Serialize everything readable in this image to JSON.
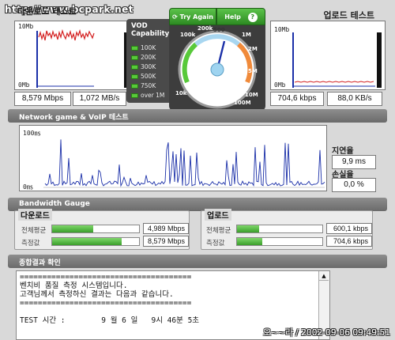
{
  "watermark": "http://www.bcpark.net",
  "download_section": {
    "title": "다운로드 테스트"
  },
  "upload_section": {
    "title": "업로드 테스트"
  },
  "download_chart": {
    "ymax_label": "10Mb",
    "ymin_label": "0Mb",
    "speed_readout": "8,579 Mbps",
    "bytes_readout": "1,072 MB/s"
  },
  "upload_chart": {
    "ymax_label": "10Mb",
    "ymin_label": "0Mb",
    "speed_readout": "704,6 kbps",
    "bytes_readout": "88,0 KB/s"
  },
  "vod": {
    "title_line1": "VOD",
    "title_line2": "Capability",
    "levels": [
      "100K",
      "200K",
      "300K",
      "500K",
      "750K",
      "over 1M"
    ]
  },
  "gauge": {
    "try_again_label": "Try Again",
    "help_label": "Help",
    "help_icon": "?",
    "scale_labels": [
      "100k",
      "200k",
      "500",
      "1M",
      "2M",
      "5M",
      "10M",
      "100M",
      "10k"
    ],
    "needle_value": "8,579 Mbps"
  },
  "network_section": {
    "title": "Network game & VoIP 테스트",
    "ymax_label": "100㎳",
    "ymin_label": "0㎳",
    "latency_label": "지연율",
    "latency_value": "9,9 ms",
    "loss_label": "손실율",
    "loss_value": "0,0 %"
  },
  "bandwidth_section": {
    "title": "Bandwidth Gauge",
    "download": {
      "title": "다운로드",
      "avg_label": "전체평균",
      "avg_value": "4,989 Mbps",
      "avg_fraction": 0.47,
      "measured_label": "측정값",
      "measured_value": "8,579 Mbps",
      "measured_fraction": 0.8
    },
    "upload": {
      "title": "업로드",
      "avg_label": "전체평균",
      "avg_value": "600,1 kbps",
      "avg_fraction": 0.26,
      "measured_label": "측정값",
      "measured_value": "704,6 kbps",
      "measured_fraction": 0.3
    }
  },
  "result_section": {
    "title": "종합결과 확인",
    "text": "======================================\n벤치비 품질 측정 시스템입니다.\n고객님께서 측정하신 결과는 다음과 같습니다.\n======================================\n\nTEST 시간 :        9 월 6 일   9시 46분 5초"
  },
  "timestamp": "오~~라 / 2002-09-06 09:49:51",
  "colors": {
    "accent_green": "#3a9e2b",
    "chart_red": "#d42020",
    "chart_blue": "#1a2fa8",
    "gauge_dark": "#3d3d3d"
  }
}
